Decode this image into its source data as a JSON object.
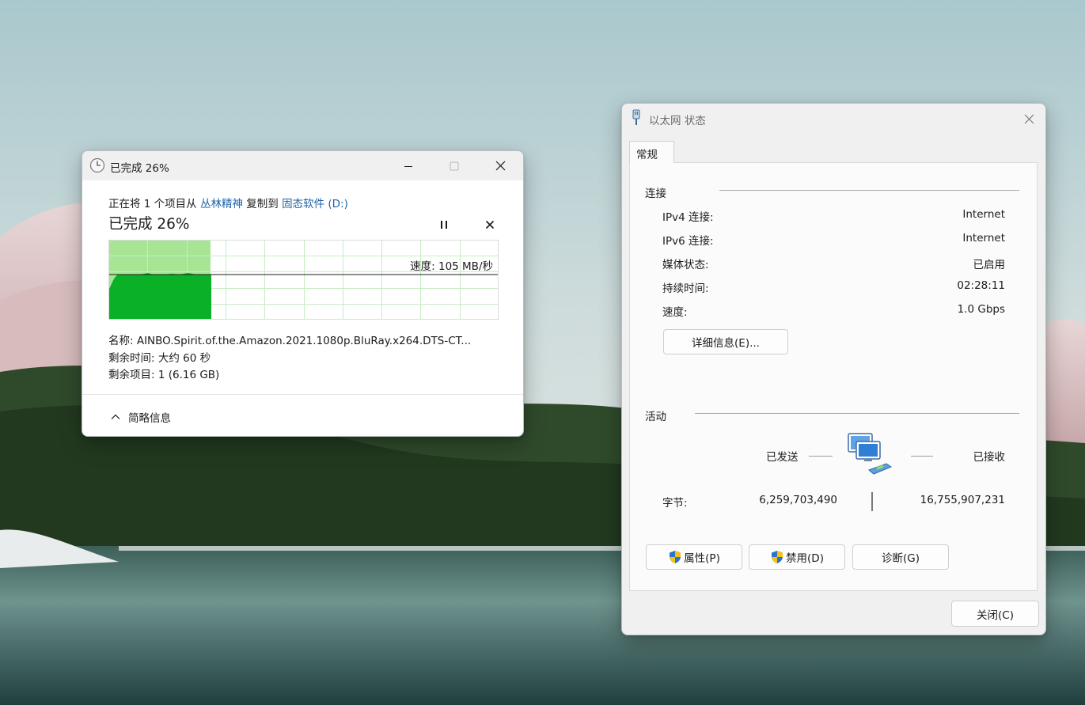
{
  "copy_dialog": {
    "title": "已完成 26%",
    "line_prefix": "正在将 1 个项目从 ",
    "source": "丛林精神",
    "line_middle": " 复制到 ",
    "destination": "固态软件 (D:)",
    "progress_heading": "已完成 26%",
    "progress_percent": 26,
    "speed": "速度: 105 MB/秒",
    "name": "名称: AINBO.Spirit.of.the.Amazon.2021.1080p.BluRay.x264.DTS-CT...",
    "time_remaining": "剩余时间: 大约 60 秒",
    "items_remaining": "剩余项目: 1 (6.16 GB)",
    "collapse_label": "简略信息",
    "colors": {
      "graph_fill": "#0ab126",
      "graph_progress_bg": "#a7e595",
      "grid": "#c7ecc2",
      "link": "#1c62a8"
    }
  },
  "ethernet_dialog": {
    "title": "以太网 状态",
    "tab": "常规",
    "connection_group": "连接",
    "rows": [
      {
        "label": "IPv4 连接:",
        "value": "Internet"
      },
      {
        "label": "IPv6 连接:",
        "value": "Internet"
      },
      {
        "label": "媒体状态:",
        "value": "已启用"
      },
      {
        "label": "持续时间:",
        "value": "02:28:11"
      },
      {
        "label": "速度:",
        "value": "1.0 Gbps"
      }
    ],
    "details_button": "详细信息(E)...",
    "activity_group": "活动",
    "sent_label": "已发送",
    "received_label": "已接收",
    "bytes_label": "字节:",
    "bytes_sent": "6,259,703,490",
    "bytes_received": "16,755,907,231",
    "properties_button": "属性(P)",
    "disable_button": "禁用(D)",
    "diagnose_button": "诊断(G)",
    "close_button": "关闭(C)"
  }
}
